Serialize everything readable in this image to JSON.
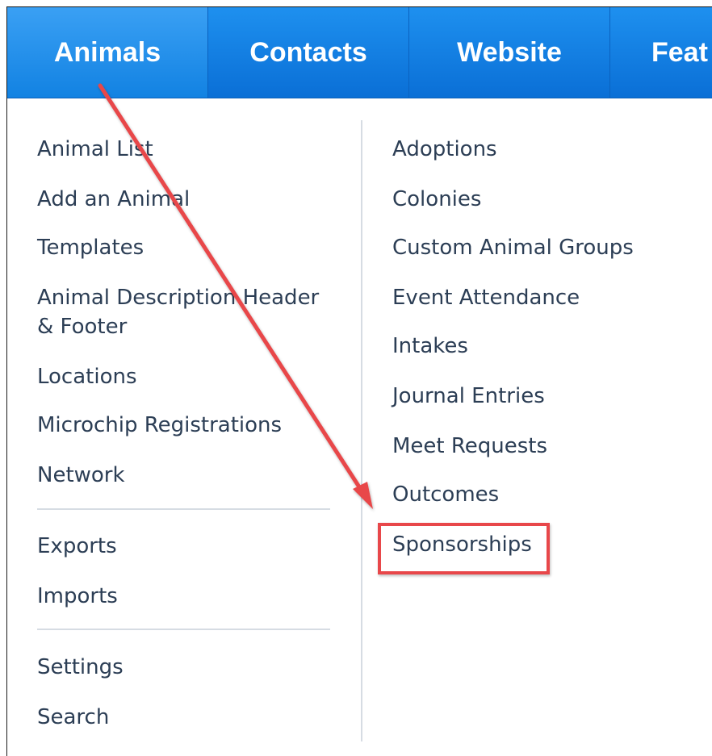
{
  "nav": {
    "tabs": [
      {
        "label": "Animals",
        "active": true
      },
      {
        "label": "Contacts",
        "active": false
      },
      {
        "label": "Website",
        "active": false
      },
      {
        "label": "Feat",
        "active": false
      }
    ]
  },
  "menu": {
    "left": {
      "group1": [
        "Animal List",
        "Add an Animal",
        "Templates",
        "Animal Description Header",
        "& Footer",
        "Locations",
        "Microchip Registrations",
        "Network"
      ],
      "group2": [
        "Exports",
        "Imports"
      ],
      "group3": [
        "Settings",
        "Search"
      ]
    },
    "right": [
      "Adoptions",
      "Colonies",
      "Custom Animal Groups",
      "Event Attendance",
      "Intakes",
      "Journal Entries",
      "Meet Requests",
      "Outcomes",
      "Sponsorships"
    ]
  },
  "annotation": {
    "highlighted_item": "Sponsorships",
    "color": "#e8474a"
  },
  "colors": {
    "nav_background": "#0a6fd6",
    "nav_active": "#3aa0f4",
    "menu_text": "#2c3e55",
    "divider": "#d6dce3"
  }
}
